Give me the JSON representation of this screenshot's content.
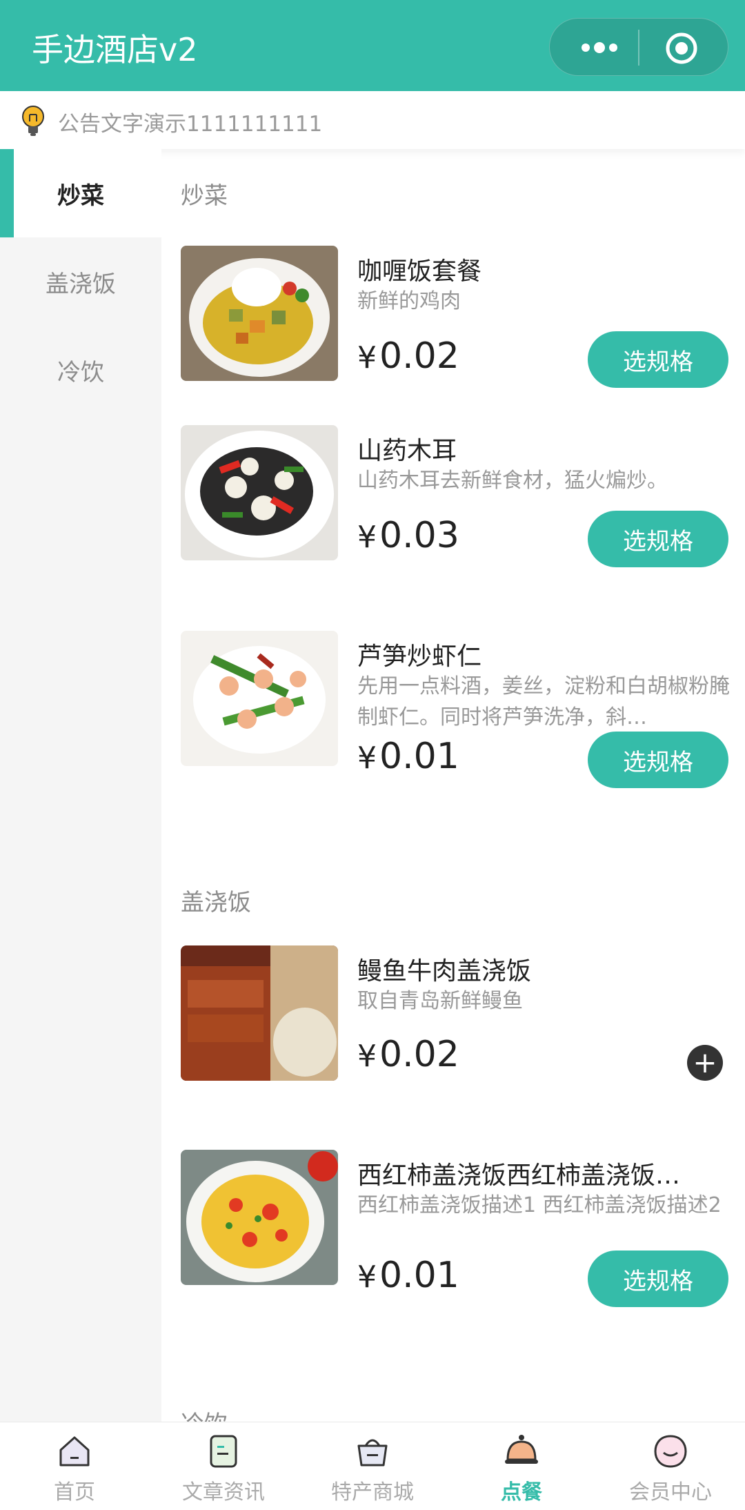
{
  "header": {
    "title": "手边酒店v2",
    "menu_icon": "more-dots-icon",
    "close_icon": "target-circle-icon"
  },
  "notice": {
    "icon": "lightbulb-icon",
    "text": "公告文字演示1111111111"
  },
  "sidebar": {
    "items": [
      "炒菜",
      "盖浇饭",
      "冷饮"
    ],
    "active": 0
  },
  "sections": [
    {
      "title": "炒菜",
      "items": [
        {
          "name": "咖喱饭套餐",
          "desc": "新鲜的鸡肉",
          "price": "0.02",
          "action": "选规格"
        },
        {
          "name": "山药木耳",
          "desc": "山药木耳去新鲜食材，猛火煸炒。",
          "price": "0.03",
          "action": "选规格"
        },
        {
          "name": "芦笋炒虾仁",
          "desc": "先用一点料酒，姜丝，淀粉和白胡椒粉腌制虾仁。同时将芦笋洗净，斜…",
          "price": "0.01",
          "action": "选规格"
        }
      ]
    },
    {
      "title": "盖浇饭",
      "items": [
        {
          "name": "鳗鱼牛肉盖浇饭",
          "desc": "取自青岛新鲜鳗鱼",
          "price": "0.02",
          "action": "+"
        },
        {
          "name": "西红柿盖浇饭西红柿盖浇饭…",
          "desc": "西红柿盖浇饭描述1 西红柿盖浇饭描述2",
          "price": "0.01",
          "action": "选规格"
        }
      ]
    },
    {
      "title": "冷饮",
      "items": []
    }
  ],
  "currency": "¥",
  "tabbar": {
    "items": [
      {
        "label": "首页",
        "icon": "home-icon"
      },
      {
        "label": "文章资讯",
        "icon": "article-icon"
      },
      {
        "label": "特产商城",
        "icon": "shopping-bag-icon"
      },
      {
        "label": "点餐",
        "icon": "service-bell-icon"
      },
      {
        "label": "会员中心",
        "icon": "member-face-icon"
      }
    ],
    "active": 3
  },
  "colors": {
    "primary": "#35bca9",
    "sidebar_bg": "#f5f5f5",
    "text_muted": "#999999"
  }
}
